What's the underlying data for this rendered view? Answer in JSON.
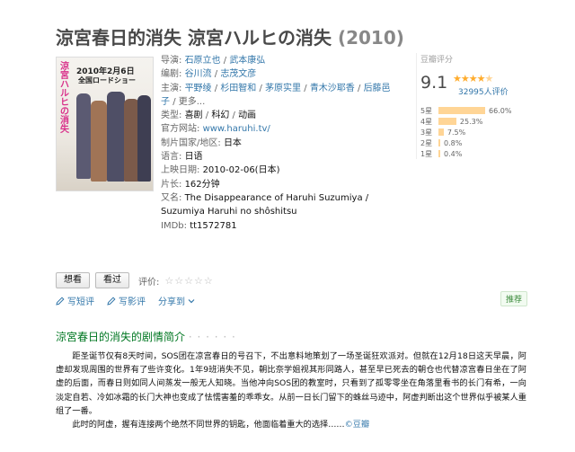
{
  "title": {
    "name": "涼宮春日的消失 涼宮ハルヒの消失",
    "year": "(2010)"
  },
  "poster": {
    "vertical_text": "涼宮ハルヒの消失",
    "date_text": "2010年2月6日",
    "sub_text": "全国ロードショー"
  },
  "info": {
    "director_label": "导演:",
    "directors": [
      "石原立也",
      "武本康弘"
    ],
    "writer_label": "编剧:",
    "writers": [
      "谷川流",
      "志茂文彦"
    ],
    "cast_label": "主演:",
    "cast": [
      "平野绫",
      "杉田智和",
      "茅原实里",
      "青木沙耶香",
      "后藤邑子"
    ],
    "more": "更多...",
    "genre_label": "类型:",
    "genres": [
      "喜剧",
      "科幻",
      "动画"
    ],
    "site_label": "官方网站:",
    "site": "www.haruhi.tv/",
    "country_label": "制片国家/地区:",
    "country": "日本",
    "language_label": "语言:",
    "language": "日语",
    "release_label": "上映日期:",
    "release": "2010-02-06(日本)",
    "runtime_label": "片长:",
    "runtime": "162分钟",
    "aka_label": "又名:",
    "aka": "The Disappearance of Haruhi Suzumiya / Suzumiya Haruhi no shôshitsu",
    "imdb_label": "IMDb:",
    "imdb": "tt1572781"
  },
  "rating": {
    "label": "豆瓣评分",
    "score": "9.1",
    "stars": 4.5,
    "count": "32995人评价",
    "breakdown": [
      {
        "label": "5星",
        "percent": 66.0,
        "text": "66.0%"
      },
      {
        "label": "4星",
        "percent": 25.3,
        "text": "25.3%"
      },
      {
        "label": "3星",
        "percent": 7.5,
        "text": "7.5%"
      },
      {
        "label": "2星",
        "percent": 0.8,
        "text": "0.8%"
      },
      {
        "label": "1星",
        "percent": 0.4,
        "text": "0.4%"
      }
    ]
  },
  "actions": {
    "want": "想看",
    "seen": "看过",
    "rate_label": "评价:",
    "short_review": "写短评",
    "review": "写影评",
    "share": "分享到",
    "recommend": "推荐"
  },
  "summary": {
    "title": "涼宮春日的消失的剧情简介",
    "dots": "· · · · · ·",
    "p1": "距圣诞节仅有8天时间，SOS团在凉宫春日的号召下，不出意料地策划了一场圣诞狂欢派对。但就在12月18日这天早晨，阿虚却发现周围的世界有了些许变化。1年9班消失不见，朝比奈学姐视其形同路人，甚至早已死去的朝仓也代替凉宫春日坐在了阿虚的后面，而春日则如同人间蒸发一般无人知晓。当他冲向SOS团的教室时，只看到了孤零零坐在角落里看书的长门有希，一向淡定自若、冷如冰霜的长门大神也变成了怯懦害羞的乖乖女。从前一日长门留下的蛛丝马迹中，阿虚判断出这个世界似乎被某人重组了一番。",
    "p2": "此时的阿虚，握有连接两个绝然不同世界的钥匙，他面临着重大的选择……",
    "source": "©豆瓣"
  },
  "colors": {
    "link": "#3377aa",
    "green": "#007722",
    "star": "#ffac2d",
    "bar": "#ffd596"
  }
}
